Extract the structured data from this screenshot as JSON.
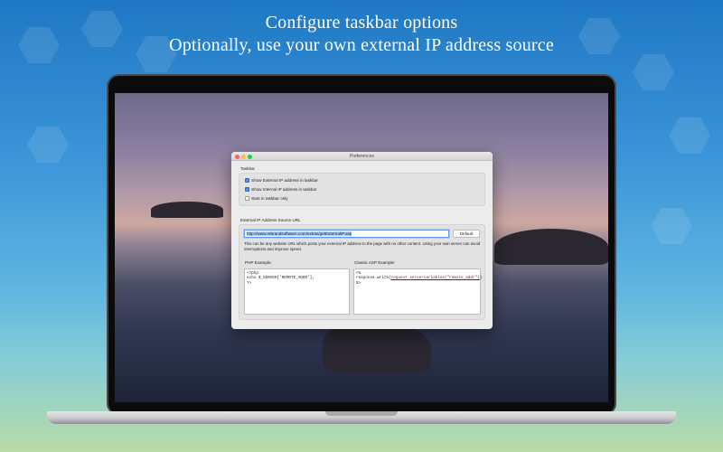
{
  "headline": {
    "line1": "Configure taskbar options",
    "line2": "Optionally, use your own external IP address source"
  },
  "window": {
    "title": "Preferences",
    "taskbar_section": "Taskbar",
    "checkboxes": [
      {
        "label": "Show External IP address in taskbar",
        "checked": true
      },
      {
        "label": "Show Internal IP address in taskbar",
        "checked": true
      },
      {
        "label": "Start in taskbar only",
        "checked": false
      }
    ],
    "source_section": "External IP Address Source URL",
    "url_value": "http://www.rebrandsoftware.com/extras/getExternalIP.asp",
    "default_button": "Default",
    "note": "This can be any website URL which posts your external IP address to the page with no other content.  Using your own server can avoid interruptions and improve speed.",
    "php_label": "PHP Example:",
    "php_code": [
      "<?php",
      "echo $_SERVER['REMOTE_ADDR'];",
      "?>"
    ],
    "asp_label": "Classic ASP Example:",
    "asp_code_line1": "<%",
    "asp_code_prefix": "response.write(",
    "asp_code_link": "request.servervariables(\"remote_addr\")",
    "asp_code_suffix": ")",
    "asp_code_line3": "%>"
  },
  "colors": {
    "accent": "#2d7cf6",
    "background_top": "#1f78c4",
    "background_bottom": "#b9dca6"
  }
}
